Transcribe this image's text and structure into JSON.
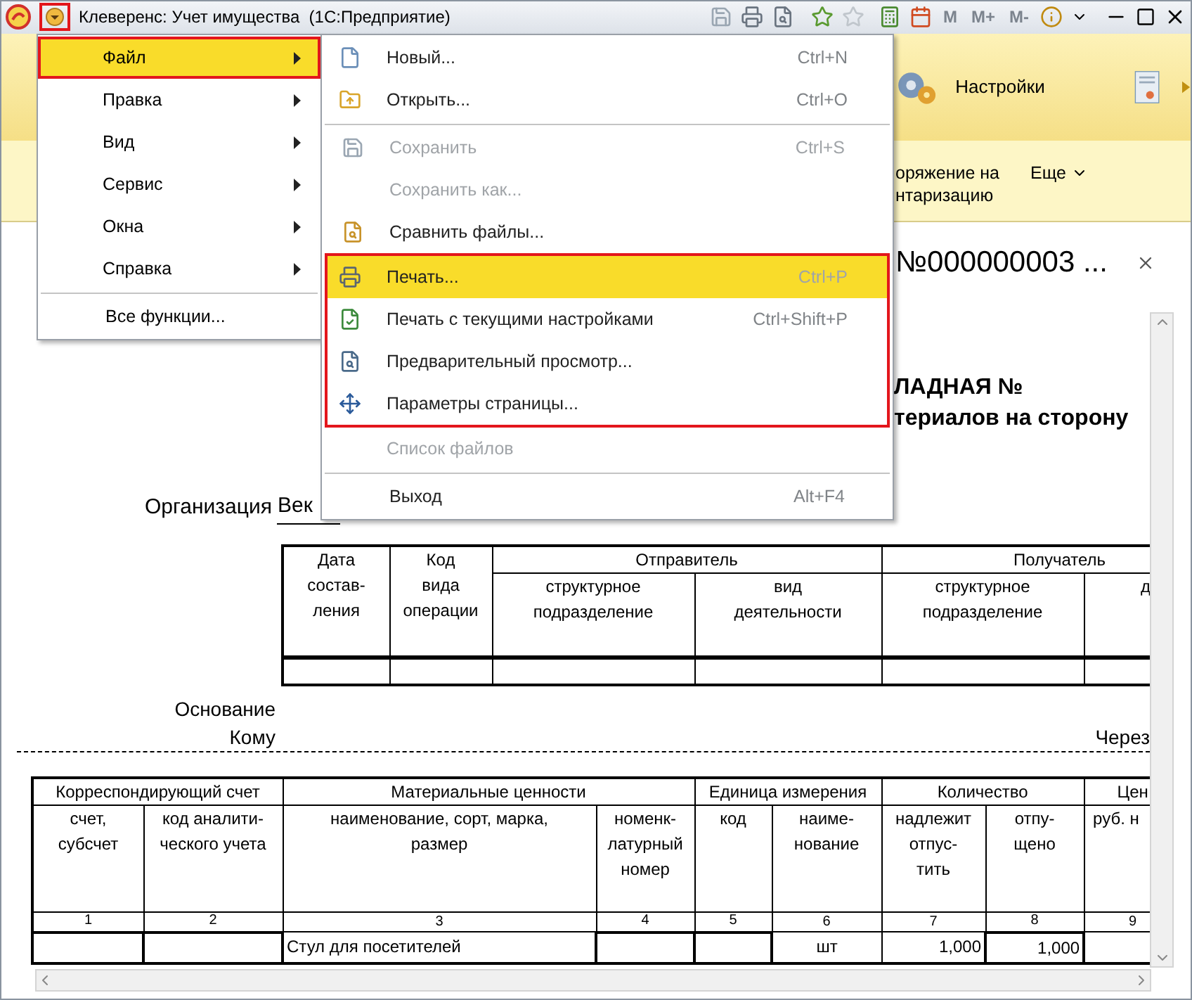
{
  "title_bar": {
    "title": "Клеверенс: Учет имущества  (1С:Предприятие)",
    "menu_button_outlined": true,
    "memory_keys": [
      "M",
      "M+",
      "M-"
    ]
  },
  "section_panel": {
    "label": "Настройки"
  },
  "command_bar": {
    "cut_command": "оряжение на\nнтаризацию",
    "more_button": "Еще"
  },
  "form": {
    "title": "№000000003 ..."
  },
  "document": {
    "heading_lines": [
      "ЛАДНАЯ №",
      "териалов на сторону"
    ],
    "organization_label": "Организация",
    "organization_value": "Век",
    "header_table": {
      "col_date": "Дата\nсостав-\nления",
      "col_operation": "Код\nвида\nоперации",
      "sender": "Отправитель",
      "sender_columns": [
        "структурное\nподразделение",
        "вид\nдеятельности"
      ],
      "receiver": "Получатель",
      "receiver_columns": [
        "структурное\nподразделение",
        "д"
      ]
    },
    "basis_label": "Основание",
    "to_label": "Кому",
    "via_label": "Через",
    "items_table": {
      "groups": [
        {
          "label": "Корреспондирующий счет",
          "columns": [
            "счет,\nсубсчет",
            "код аналити-\nческого учета"
          ]
        },
        {
          "label": "Материальные ценности",
          "columns": [
            "наименование, сорт, марка,\nразмер",
            "номенк-\nлатурный\nномер"
          ]
        },
        {
          "label": "Единица измерения",
          "columns": [
            "код",
            "наиме-\nнование"
          ]
        },
        {
          "label": "Количество",
          "columns": [
            "надлежит\nотпус-\nтить",
            "отпу-\nщено"
          ]
        },
        {
          "label": "Цен",
          "columns": [
            "руб. н"
          ]
        }
      ],
      "numbers": [
        "1",
        "2",
        "3",
        "4",
        "5",
        "6",
        "7",
        "8",
        "9"
      ],
      "rows": [
        {
          "name": "Стул для посетителей",
          "unit": "шт",
          "quantity_due": "1,000",
          "quantity_released": "1,000"
        }
      ]
    }
  },
  "main_menu": {
    "items": [
      {
        "label": "Файл",
        "has_submenu": true,
        "selected": true,
        "outlined": true,
        "separator_before": false
      },
      {
        "label": "Правка",
        "has_submenu": true,
        "selected": false,
        "outlined": false,
        "separator_before": false
      },
      {
        "label": "Вид",
        "has_submenu": true,
        "selected": false,
        "outlined": false,
        "separator_before": false
      },
      {
        "label": "Сервис",
        "has_submenu": true,
        "selected": false,
        "outlined": false,
        "separator_before": false
      },
      {
        "label": "Окна",
        "has_submenu": true,
        "selected": false,
        "outlined": false,
        "separator_before": false
      },
      {
        "label": "Справка",
        "has_submenu": true,
        "selected": false,
        "outlined": false,
        "separator_before": false
      },
      {
        "label": "Все функции...",
        "has_submenu": false,
        "selected": false,
        "outlined": false,
        "separator_before": true
      }
    ]
  },
  "file_menu": {
    "groups": [
      {
        "outlined": false,
        "separator_before": false,
        "items": [
          {
            "label": "Новый...",
            "shortcut": "Ctrl+N",
            "disabled": false,
            "selected": false
          },
          {
            "label": "Открыть...",
            "shortcut": "Ctrl+O",
            "disabled": false,
            "selected": false
          }
        ]
      },
      {
        "outlined": false,
        "separator_before": true,
        "items": [
          {
            "label": "Сохранить",
            "shortcut": "Ctrl+S",
            "disabled": true,
            "selected": false
          },
          {
            "label": "Сохранить как...",
            "disabled": true,
            "selected": false
          },
          {
            "label": "Сравнить файлы...",
            "disabled": false,
            "selected": false
          }
        ]
      },
      {
        "outlined": true,
        "separator_before": false,
        "items": [
          {
            "label": "Печать...",
            "shortcut": "Ctrl+P",
            "disabled": false,
            "selected": true
          },
          {
            "label": "Печать с текущими настройками",
            "shortcut": "Ctrl+Shift+P",
            "disabled": false,
            "selected": false
          },
          {
            "label": "Предварительный просмотр...",
            "disabled": false,
            "selected": false
          },
          {
            "label": "Параметры страницы...",
            "disabled": false,
            "selected": false
          }
        ]
      },
      {
        "outlined": false,
        "separator_before": false,
        "items": [
          {
            "label": "Список файлов",
            "disabled": true,
            "selected": false
          }
        ]
      },
      {
        "outlined": false,
        "separator_before": true,
        "items": [
          {
            "label": "Выход",
            "shortcut": "Alt+F4",
            "disabled": false,
            "selected": false
          }
        ]
      }
    ]
  }
}
